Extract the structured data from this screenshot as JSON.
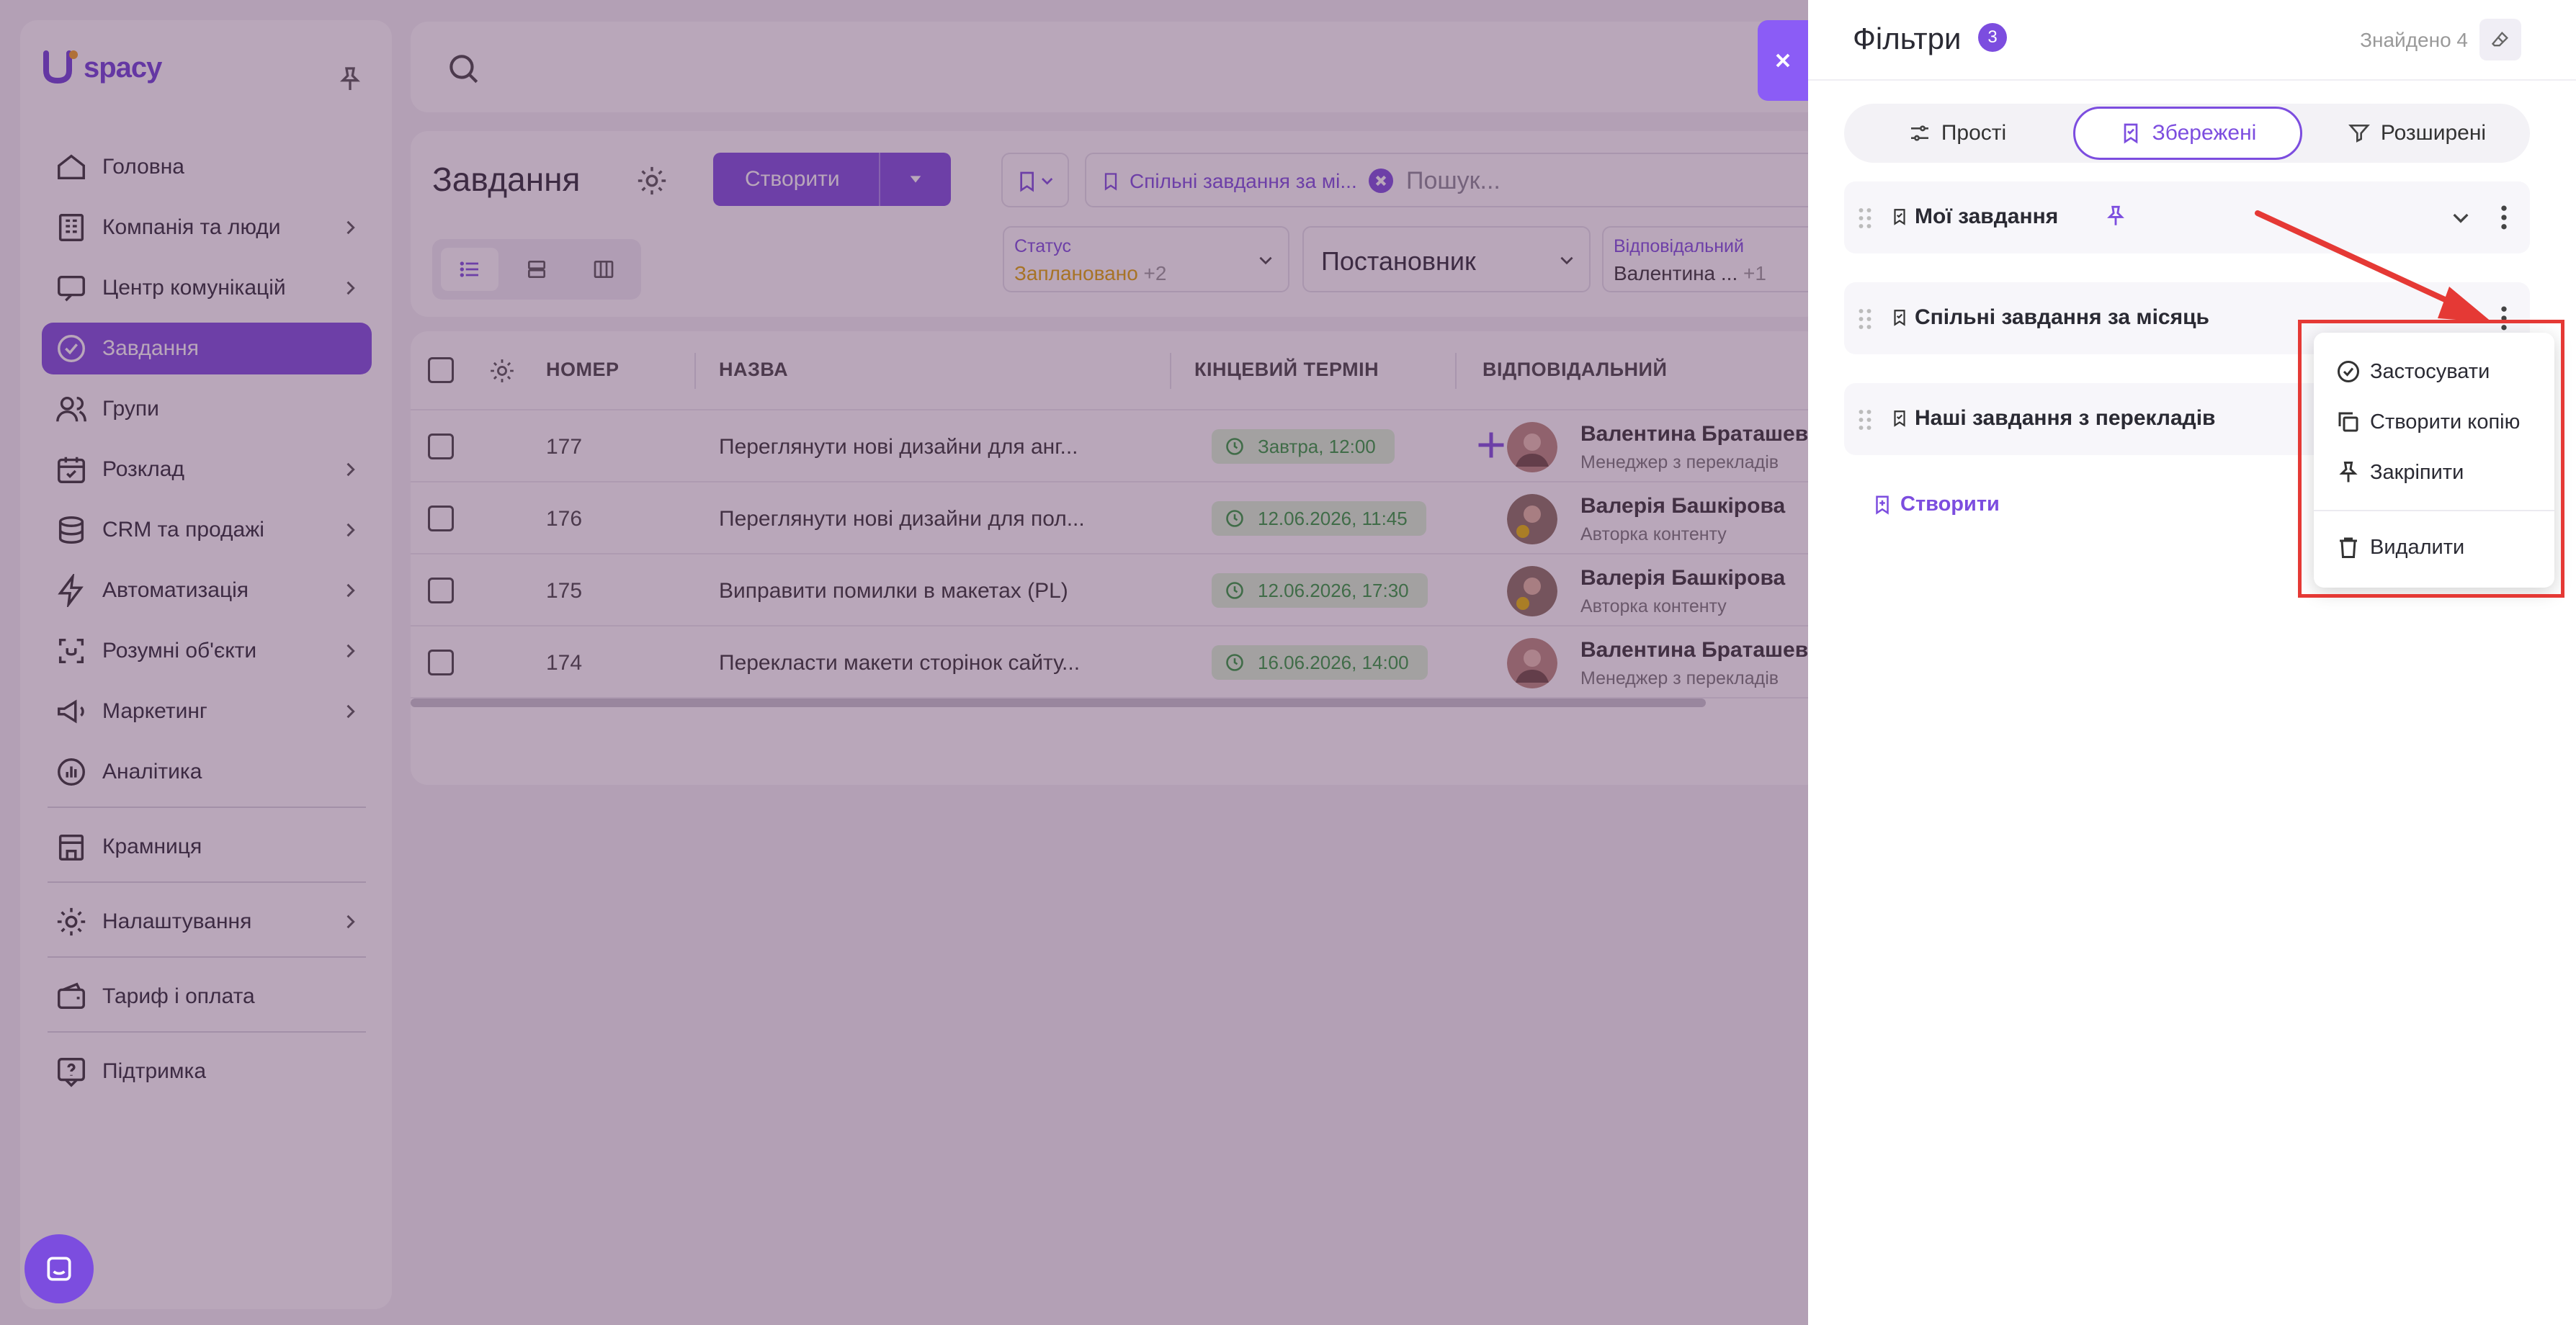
{
  "app": {
    "logo_text": "spacy"
  },
  "sidebar": {
    "items": [
      {
        "label": "Головна",
        "icon": "home-icon",
        "submenu": false
      },
      {
        "label": "Компанія та люди",
        "icon": "company-icon",
        "submenu": true
      },
      {
        "label": "Центр комунікацій",
        "icon": "communications-icon",
        "submenu": true
      },
      {
        "label": "Завдання",
        "icon": "check-circle-icon",
        "submenu": false,
        "active": true
      },
      {
        "label": "Групи",
        "icon": "groups-icon",
        "submenu": false
      },
      {
        "label": "Розклад",
        "icon": "calendar-icon",
        "submenu": true
      },
      {
        "label": "CRM та продажі",
        "icon": "coins-icon",
        "submenu": true
      },
      {
        "label": "Автоматизація",
        "icon": "lightning-icon",
        "submenu": true
      },
      {
        "label": "Розумні об'єкти",
        "icon": "smart-object-icon",
        "submenu": true
      },
      {
        "label": "Маркетинг",
        "icon": "megaphone-icon",
        "submenu": true
      },
      {
        "label": "Аналітика",
        "icon": "analytics-icon",
        "submenu": false
      }
    ],
    "bottom_items": [
      {
        "label": "Крамниця",
        "icon": "store-icon"
      },
      {
        "label": "Налаштування",
        "icon": "gear-icon"
      },
      {
        "label": "Тариф і оплата",
        "icon": "wallet-icon"
      },
      {
        "label": "Підтримка",
        "icon": "help-icon"
      }
    ]
  },
  "tasks": {
    "title": "Завдання",
    "create_label": "Створити",
    "filter_chip": "Спільні завдання за мі...",
    "search_placeholder": "Пошук...",
    "selects": {
      "status": {
        "label": "Статус",
        "value": "Заплановано",
        "extra": "+2"
      },
      "author": {
        "value": "Постановник"
      },
      "assignee": {
        "label": "Відповідальний",
        "value": "Валентина ...",
        "extra": "+1"
      }
    },
    "columns": [
      "НОМЕР",
      "НАЗВА",
      "КІНЦЕВИЙ ТЕРМІН",
      "ВІДПОВІДАЛЬНИЙ"
    ],
    "rows": [
      {
        "num": "177",
        "name": "Переглянути нові дизайни для анг...",
        "due": "Завтра, 12:00",
        "person": "Валентина Браташевс",
        "role": "Менеджер з перекладів",
        "show_add": true
      },
      {
        "num": "176",
        "name": "Переглянути нові дизайни для пол...",
        "due": "12.06.2026, 11:45",
        "person": "Валерія Башкірова",
        "role": "Авторка контенту",
        "show_add": false
      },
      {
        "num": "175",
        "name": "Виправити помилки в макетах (PL)",
        "due": "12.06.2026, 17:30",
        "person": "Валерія Башкірова",
        "role": "Авторка контенту",
        "show_add": false
      },
      {
        "num": "174",
        "name": "Перекласти макети сторінок сайту...",
        "due": "16.06.2026, 14:00",
        "person": "Валентина Браташевс",
        "role": "Менеджер з перекладів",
        "show_add": false
      }
    ]
  },
  "filters": {
    "title": "Фільтри",
    "badge": "3",
    "found": "Знайдено 4",
    "tabs": [
      {
        "label": "Прості",
        "icon": "sliders-icon",
        "active": false
      },
      {
        "label": "Збережені",
        "icon": "bookmark-icon",
        "active": true
      },
      {
        "label": "Розширені",
        "icon": "filter-icon",
        "active": false
      }
    ],
    "saved": [
      {
        "label": "Мої завдання",
        "pinned": true
      },
      {
        "label": "Спільні завдання за місяць",
        "pinned": false
      },
      {
        "label": "Наші завдання з перекладів",
        "pinned": false
      }
    ],
    "create_label": "Створити",
    "context_menu": [
      {
        "label": "Застосувати",
        "icon": "check-circle-icon"
      },
      {
        "label": "Створити копію",
        "icon": "copy-icon"
      },
      {
        "label": "Закріпити",
        "icon": "pin-icon"
      },
      {
        "label": "Видалити",
        "icon": "trash-icon"
      }
    ]
  },
  "colors": {
    "accent": "#7c4ddf",
    "overlay": "#582d5a",
    "highlight": "#e53935",
    "due_bg": "#d9f4d4",
    "due_text": "#2f9a3c"
  }
}
